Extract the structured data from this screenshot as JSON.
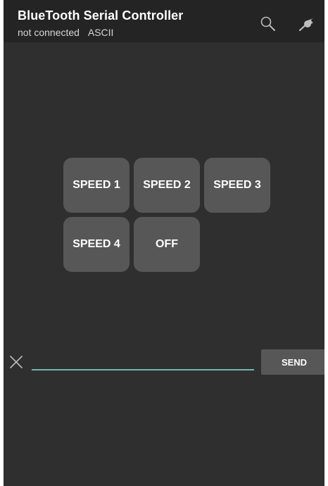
{
  "appbar": {
    "title": "BlueTooth Serial Controller",
    "status": "not connected",
    "mode": "ASCII",
    "icons": [
      "search-icon",
      "wrench-icon"
    ]
  },
  "buttons": [
    {
      "label": "SPEED 1"
    },
    {
      "label": "SPEED 2"
    },
    {
      "label": "SPEED 3"
    },
    {
      "label": "SPEED 4"
    },
    {
      "label": "OFF"
    }
  ],
  "command": {
    "value": "",
    "placeholder": "",
    "send_label": "SEND",
    "clear_icon": "close-icon"
  },
  "colors": {
    "background": "#2f2f2f",
    "appbar": "#242424",
    "button": "#575757",
    "input_underline": "#70b8ad"
  }
}
